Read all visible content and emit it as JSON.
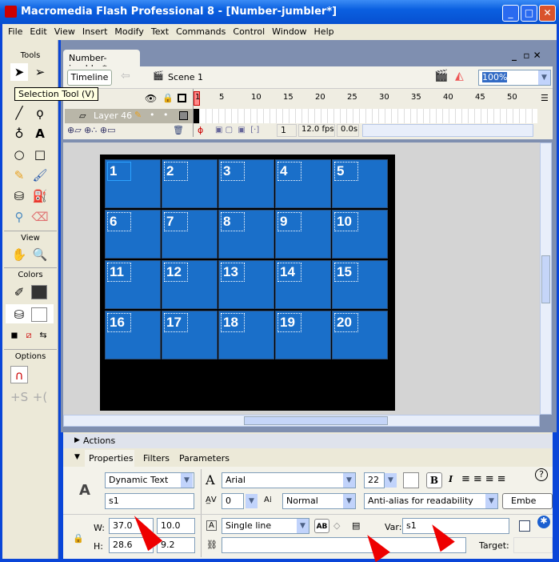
{
  "window": {
    "title": "Macromedia Flash Professional 8 - [Number-jumbler*]",
    "minimize": "_",
    "maximize": "□",
    "close": "✕"
  },
  "menu": [
    "File",
    "Edit",
    "View",
    "Insert",
    "Modify",
    "Text",
    "Commands",
    "Control",
    "Window",
    "Help"
  ],
  "tools": {
    "title": "Tools",
    "tooltip": "Selection Tool (V)",
    "view_label": "View",
    "colors_label": "Colors",
    "options_label": "Options"
  },
  "document": {
    "tab": "Number-jumbler*",
    "timeline_button": "Timeline",
    "scene": "Scene 1",
    "zoom": "100%"
  },
  "timeline": {
    "layer": "Layer 46",
    "frame_numbers": [
      "1",
      "5",
      "10",
      "15",
      "20",
      "25",
      "30",
      "35",
      "40",
      "45",
      "50"
    ],
    "current_frame": "1",
    "fps": "12.0 fps",
    "time": "0.0s"
  },
  "stage": {
    "cells": [
      "1",
      "2",
      "3",
      "4",
      "5",
      "6",
      "7",
      "8",
      "9",
      "10",
      "11",
      "12",
      "13",
      "14",
      "15",
      "16",
      "17",
      "18",
      "19",
      "20"
    ],
    "cell_color": "#1a6fc9"
  },
  "panels": {
    "actions": "Actions",
    "tabs": [
      "Properties",
      "Filters",
      "Parameters"
    ]
  },
  "properties": {
    "text_type": "Dynamic Text",
    "instance_name": "s1",
    "font": "Arial",
    "font_size": "22",
    "letter_spacing": "0",
    "position": "Normal",
    "anti_alias": "Anti-alias for readability",
    "embed": "Embe",
    "w_label": "W:",
    "w": "37.0",
    "x": "10.0",
    "h_label": "H:",
    "h": "28.6",
    "y": "9.2",
    "line_type": "Single line",
    "var_label": "Var:",
    "var": "s1",
    "target_label": "Target:",
    "bold": "B",
    "italic": "I"
  }
}
